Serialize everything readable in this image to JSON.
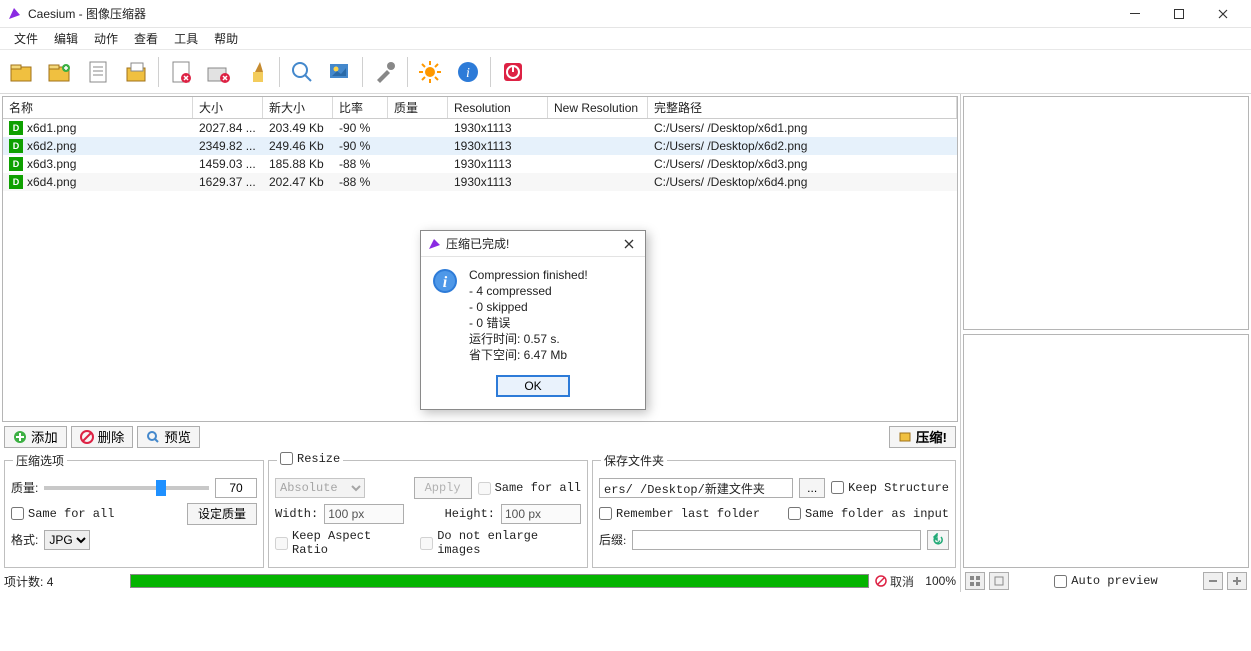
{
  "title": "Caesium - 图像压缩器",
  "menus": [
    "文件",
    "编辑",
    "动作",
    "查看",
    "工具",
    "帮助"
  ],
  "toolbar_icons": [
    "open-file-icon",
    "open-folder-icon",
    "file-page-icon",
    "export-list-icon",
    "remove-item-icon",
    "remove-error-icon",
    "broom-icon",
    "zoom-in-icon",
    "preview-refresh-icon",
    "settings-wrench-icon",
    "gear-icon",
    "about-icon",
    "power-icon"
  ],
  "columns": {
    "name": "名称",
    "size": "大小",
    "new_size": "新大小",
    "ratio": "比率",
    "quality": "质量",
    "resolution": "Resolution",
    "new_resolution": "New Resolution",
    "full_path": "完整路径"
  },
  "rows": [
    {
      "name": "x6d1.png",
      "size": "2027.84 ...",
      "new_size": "203.49 Kb",
      "ratio": "-90 %",
      "quality": "",
      "resolution": "1930x1113",
      "new_resolution": "",
      "path": "C:/Users/        /Desktop/x6d1.png",
      "selected": false
    },
    {
      "name": "x6d2.png",
      "size": "2349.82 ...",
      "new_size": "249.46 Kb",
      "ratio": "-90 %",
      "quality": "",
      "resolution": "1930x1113",
      "new_resolution": "",
      "path": "C:/Users/        /Desktop/x6d2.png",
      "selected": true
    },
    {
      "name": "x6d3.png",
      "size": "1459.03 ...",
      "new_size": "185.88 Kb",
      "ratio": "-88 %",
      "quality": "",
      "resolution": "1930x1113",
      "new_resolution": "",
      "path": "C:/Users/        /Desktop/x6d3.png",
      "selected": false
    },
    {
      "name": "x6d4.png",
      "size": "1629.37 ...",
      "new_size": "202.47 Kb",
      "ratio": "-88 %",
      "quality": "",
      "resolution": "1930x1113",
      "new_resolution": "",
      "path": "C:/Users/        /Desktop/x6d4.png",
      "selected": false
    }
  ],
  "list_actions": {
    "add": "添加",
    "remove": "删除",
    "preview": "预览",
    "compress": "压缩!"
  },
  "panels": {
    "compress": {
      "title": "压缩选项",
      "quality_label": "质量:",
      "quality_value": "70",
      "same_for_all": "Same for all",
      "set_quality": "设定质量",
      "format_label": "格式:",
      "format_value": "JPG"
    },
    "resize": {
      "title": "Resize",
      "mode": "Absolute",
      "apply": "Apply",
      "same_for_all": "Same for all",
      "width_label": "Width:",
      "width_value": "100 px",
      "height_label": "Height:",
      "height_value": "100 px",
      "keep_aspect": "Keep Aspect Ratio",
      "no_enlarge": "Do not enlarge images"
    },
    "save": {
      "title": "保存文件夹",
      "path": "ers/       /Desktop/新建文件夹",
      "browse": "...",
      "keep_structure": "Keep Structure",
      "remember": "Remember last folder",
      "same_input": "Same folder as input",
      "suffix_label": "后缀:",
      "suffix_value": ""
    }
  },
  "progress": {
    "count_label": "项计数:",
    "count": "4",
    "cancel": "取消",
    "percent": "100%"
  },
  "preview_footer": {
    "auto_preview": "Auto preview"
  },
  "dialog": {
    "title": "压缩已完成!",
    "lines": [
      "Compression finished!",
      "- 4 compressed",
      "- 0 skipped",
      "- 0 错误",
      "运行时间: 0.57 s.",
      "省下空间: 6.47 Mb"
    ],
    "ok": "OK"
  }
}
